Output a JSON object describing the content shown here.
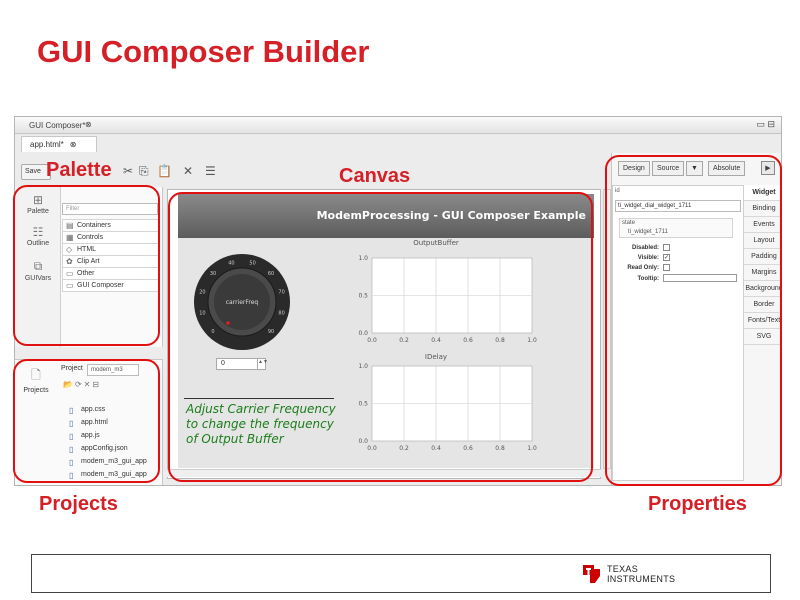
{
  "slide": {
    "title": "GUI Composer Builder"
  },
  "annotations": {
    "palette": "Palette",
    "canvas": "Canvas",
    "projects": "Projects",
    "properties": "Properties"
  },
  "window": {
    "tab_title": "GUI Composer*",
    "tab_close": "⊗",
    "controls": "▭ ⊟",
    "editor_tab": "app.html*",
    "editor_tab_close": "⊗"
  },
  "toolbar": {
    "save_label": "Save"
  },
  "palette": {
    "tabs": [
      "Palette",
      "Outline",
      "GUIVars"
    ],
    "filter_placeholder": "Filter",
    "items": [
      "Containers",
      "Controls",
      "HTML",
      "Clip Art",
      "Other",
      "GUI Composer"
    ]
  },
  "projects": {
    "tab_label": "Projects",
    "project_label": "Project",
    "project_value": "modem_m3",
    "files": [
      "app.css",
      "app.html",
      "app.js",
      "appConfig.json",
      "modem_m3_gui_app",
      "modem_m3_gui_app"
    ]
  },
  "canvas": {
    "header_title": "ModemProcessing - GUI Composer Example",
    "knob_label": "carrierFreq",
    "knob_ticks": [
      "0",
      "10",
      "20",
      "30",
      "40",
      "50",
      "60",
      "70",
      "80",
      "90"
    ],
    "input_value": "0",
    "hint_text": "Adjust Carrier Frequency to change the frequency of Output Buffer",
    "plot1": {
      "title": "OutputBuffer",
      "xticks": [
        "0.0",
        "0.2",
        "0.4",
        "0.6",
        "0.8",
        "1.0"
      ],
      "yticks": [
        "1.0",
        "0.5",
        "0.0"
      ]
    },
    "plot2": {
      "title": "IDelay",
      "xticks": [
        "0.0",
        "0.2",
        "0.4",
        "0.6",
        "0.8",
        "1.0"
      ],
      "yticks": [
        "1.0",
        "0.5",
        "0.0"
      ]
    }
  },
  "properties": {
    "design_btn": "Design",
    "source_btn": "Source",
    "dropdown_btn": "▼",
    "layout_select": "Absolute",
    "run_btn": "▶",
    "header": "id",
    "id_value": "ti_widget_dial_widget_1711",
    "state_label": "state",
    "state_value": "ti_widget_1711",
    "rows": [
      {
        "label": "Disabled:",
        "checked": ""
      },
      {
        "label": "Visible:",
        "checked": "✓"
      },
      {
        "label": "Read Only:",
        "checked": ""
      }
    ],
    "tooltip_label": "Tooltip:",
    "side_tabs": [
      "Widget",
      "Binding",
      "Events",
      "Layout",
      "Padding",
      "Margins",
      "Background",
      "Border",
      "Fonts/Text",
      "SVG"
    ]
  },
  "footer": {
    "logo_line1": "TEXAS",
    "logo_line2": "INSTRUMENTS"
  },
  "colors": {
    "accent_red": "#d52027",
    "annotation_ring": "#e01010",
    "hint_green": "#1b7d1b"
  }
}
